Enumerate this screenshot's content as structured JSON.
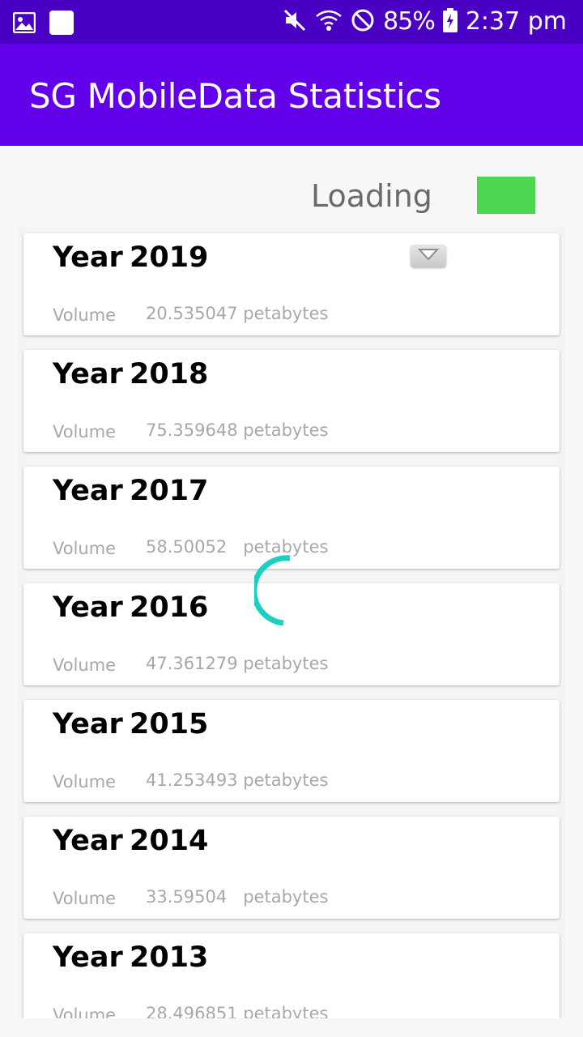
{
  "status_bar": {
    "battery": "85%",
    "time": "2:37 pm",
    "icons": [
      "image-icon",
      "square-notification-icon",
      "mute-icon",
      "wifi-icon",
      "do-not-disturb-icon",
      "battery-charging-icon"
    ]
  },
  "app_bar": {
    "title": "SG MobileData Statistics",
    "color": "#6200ea"
  },
  "loading": {
    "label": "Loading",
    "indicator_color": "#4cd752"
  },
  "list": {
    "year_label": "Year",
    "volume_label": "Volume",
    "items": [
      {
        "year": "2019",
        "volume": "20.535047 petabytes"
      },
      {
        "year": "2018",
        "volume": "75.359648 petabytes"
      },
      {
        "year": "2017",
        "volume": "58.50052   petabytes"
      },
      {
        "year": "2016",
        "volume": "47.361279 petabytes"
      },
      {
        "year": "2015",
        "volume": "41.253493 petabytes"
      },
      {
        "year": "2014",
        "volume": "33.59504   petabytes"
      },
      {
        "year": "2013",
        "volume": "28.496851 petabytes"
      }
    ]
  },
  "spinner": {
    "color": "#1dcfc2"
  }
}
